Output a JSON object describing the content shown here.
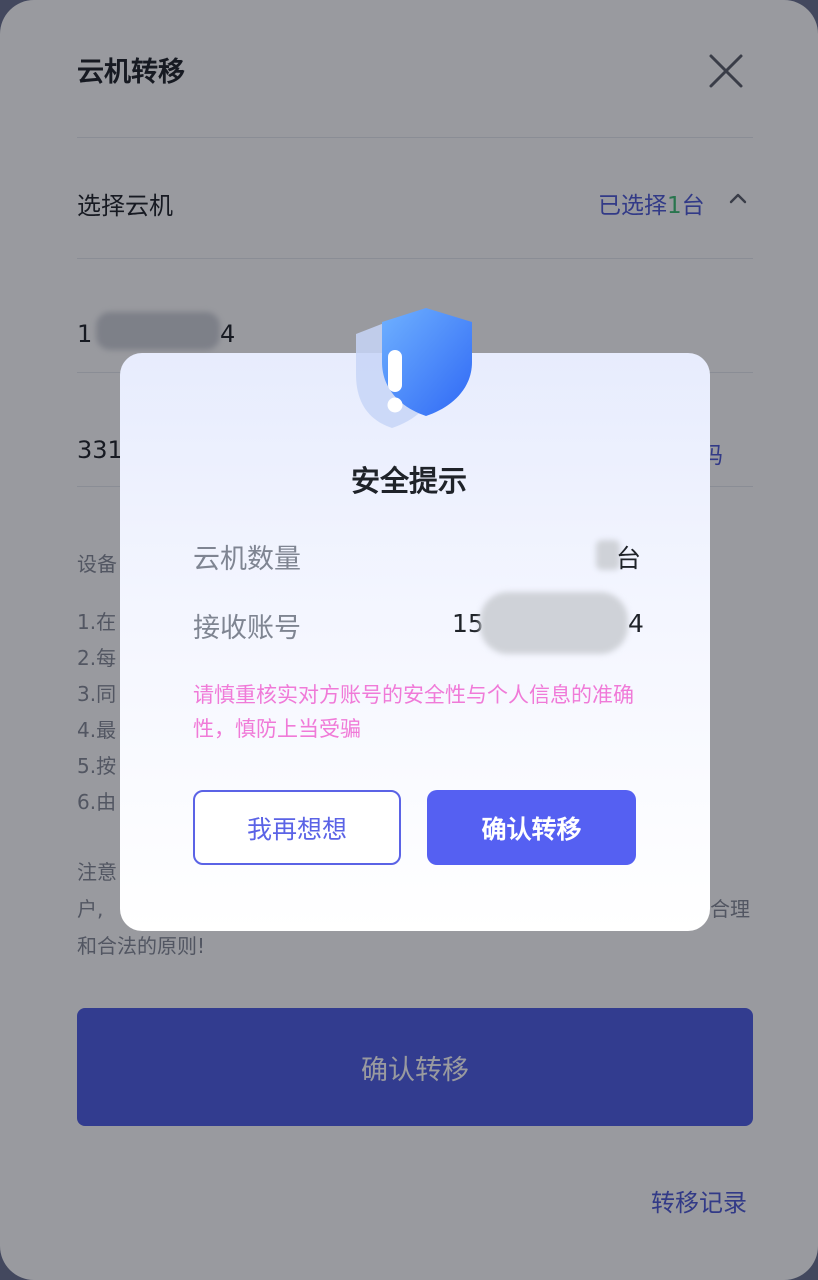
{
  "panel": {
    "title": "云机转移",
    "select_label": "选择云机",
    "selected_prefix": "已选择",
    "selected_count": "1",
    "selected_suffix": "台",
    "device_account_start": "1",
    "device_account_end": "4",
    "receiver_prefix": "331",
    "code_link": "码",
    "desc_label": "设备",
    "desc_lines": [
      "1.在",
      "2.每",
      "3.同",
      "4.最",
      "5.按",
      "6.由"
    ],
    "note_start": "注意",
    "note_line2_start": "户,",
    "note_line2_end": "合理",
    "note_line3": "和合法的原则!",
    "confirm_button": "确认转移",
    "records_link": "转移记录"
  },
  "modal": {
    "title": "安全提示",
    "quantity_label": "云机数量",
    "quantity_unit": "台",
    "receiver_label": "接收账号",
    "receiver_start": "15",
    "receiver_end": "4",
    "warning": "请慎重核实对方账号的安全性与个人信息的准确性，慎防上当受骗",
    "cancel_button": "我再想想",
    "confirm_button": "确认转移"
  },
  "colors": {
    "accent": "#4e5bd6",
    "primary_button": "#5560f2",
    "warning_text": "#f07ad8"
  },
  "icons": [
    "close-icon",
    "chevron-up-icon",
    "shield-warning-icon"
  ]
}
